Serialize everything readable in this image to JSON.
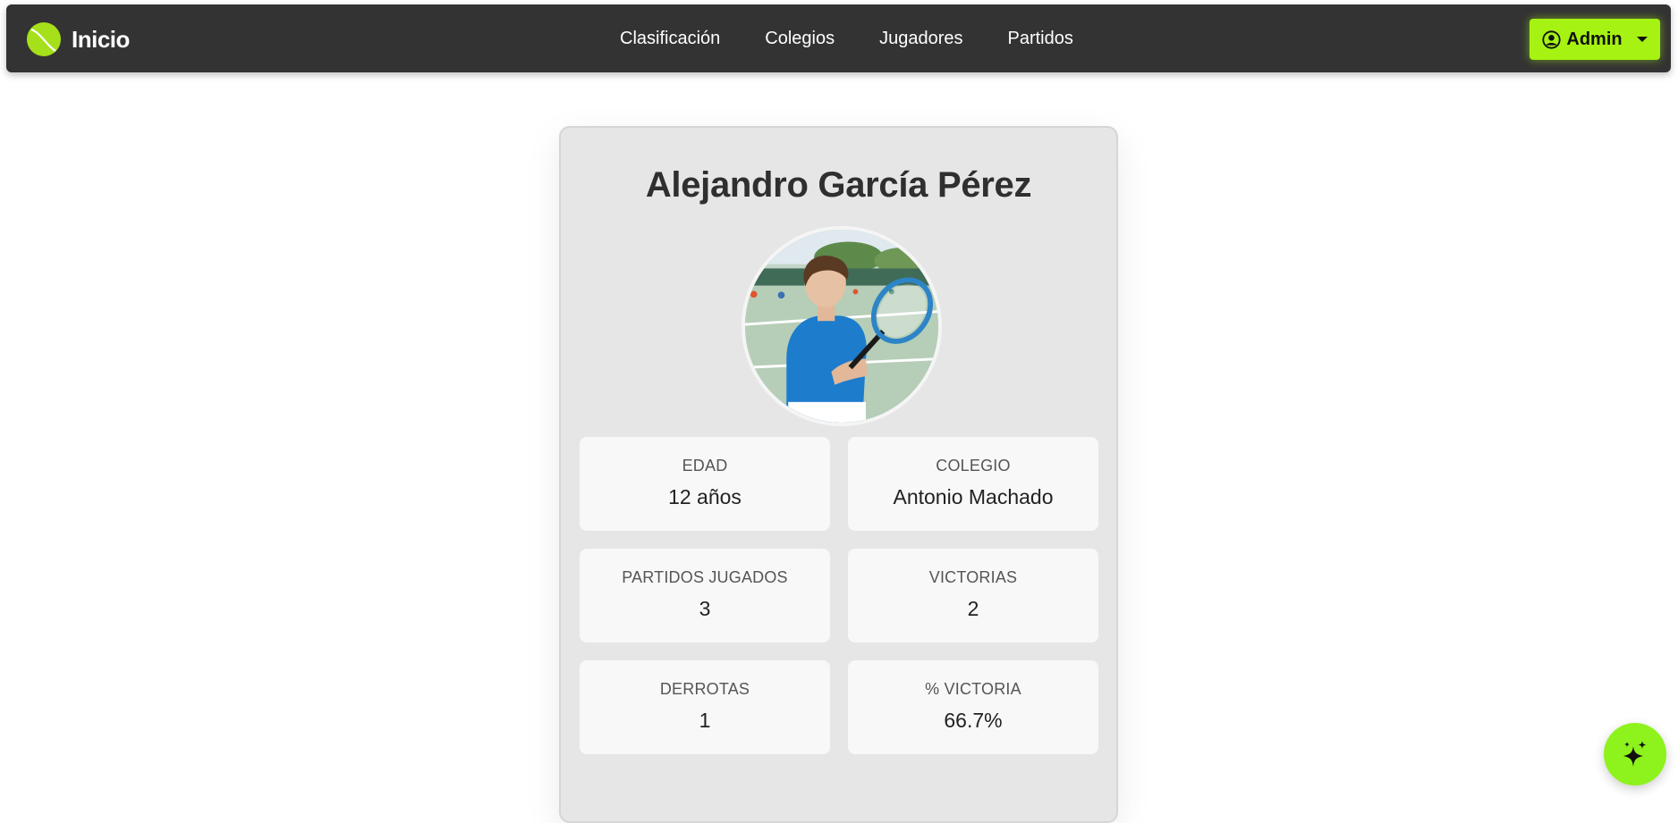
{
  "navbar": {
    "brand": "Inicio",
    "links": [
      "Clasificación",
      "Colegios",
      "Jugadores",
      "Partidos"
    ],
    "user_button": "Admin"
  },
  "player": {
    "name": "Alejandro García Pérez",
    "stats": [
      {
        "label": "EDAD",
        "value": "12 años"
      },
      {
        "label": "COLEGIO",
        "value": "Antonio Machado"
      },
      {
        "label": "PARTIDOS JUGADOS",
        "value": "3"
      },
      {
        "label": "VICTORIAS",
        "value": "2"
      },
      {
        "label": "DERROTAS",
        "value": "1"
      },
      {
        "label": "% VICTORIA",
        "value": "66.7%"
      }
    ]
  },
  "colors": {
    "navbar_bg": "#333333",
    "accent": "#a6f212",
    "fab": "#8ef21d",
    "card_bg": "#e6e6e6"
  },
  "icons": {
    "brand": "tennis-ball-icon",
    "user": "user-circle-icon",
    "dropdown": "caret-down-icon",
    "fab": "sparkles-icon"
  }
}
